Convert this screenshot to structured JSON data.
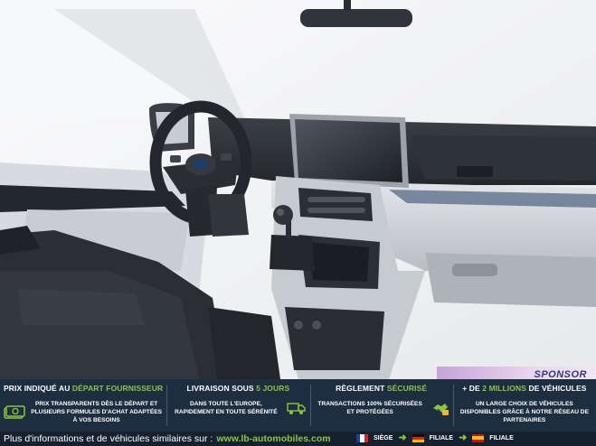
{
  "photo": {
    "subject": "van-interior-dashboard",
    "colors": {
      "wall": "#f4f5f7",
      "dash": "#2c3137",
      "trim": "#d9dde1",
      "seat": "#2a2d31"
    }
  },
  "sponsor": {
    "label": "SPONSOR"
  },
  "banner": {
    "columns": [
      {
        "title_pre": "PRIX INDIQUÉ AU",
        "title_highlight": "DÉPART FOURNISSEUR",
        "title_post": "",
        "text": "PRIX TRANSPARENTS DÈS LE DÉPART ET PLUSIEURS FORMULES D'ACHAT ADAPTÉES À VOS BESOINS",
        "icon": "money-icon"
      },
      {
        "title_pre": "LIVRAISON SOUS",
        "title_highlight": "5 JOURS",
        "title_post": "",
        "text": "DANS TOUTE L'EUROPE, RAPIDEMENT EN TOUTE SÉRÉNITÉ",
        "icon": "truck-icon"
      },
      {
        "title_pre": "RÈGLEMENT",
        "title_highlight": "SÉCURISÉ",
        "title_post": "",
        "text": "TRANSACTIONS 100% SÉCURISÉES ET PROTÉGÉES",
        "icon": "handshake-icon"
      },
      {
        "title_pre": "+ DE",
        "title_highlight": "2 MILLIONS",
        "title_post": "DE VÉHICULES",
        "text": "UN LARGE CHOIX DE VÉHICULES DISPONIBLES GRÂCE À NOTRE RÉSEAU DE PARTENAIRES",
        "icon": ""
      }
    ],
    "accent": "#8bc63f"
  },
  "footer": {
    "info": "Plus d'informations et de véhicules similaires sur :",
    "link": "www.lb-automobiles.com",
    "badges": [
      {
        "flag": "fr",
        "label": "SIÈGE"
      },
      {
        "flag": "de",
        "label": "FILIALE"
      },
      {
        "flag": "es",
        "label": "FILIALE"
      }
    ]
  }
}
